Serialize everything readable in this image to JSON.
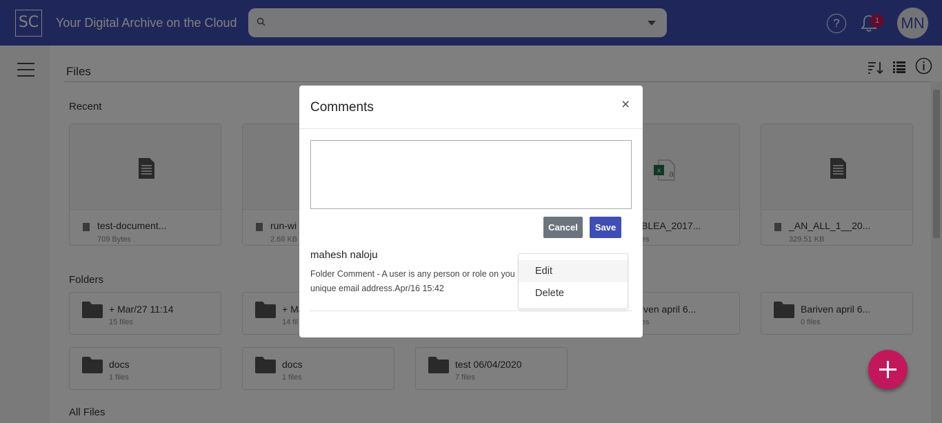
{
  "header": {
    "logo": "SC",
    "title": "Your Digital Archive on the Cloud",
    "search_placeholder": "",
    "help": "?",
    "notifications_count": "1",
    "avatar_initials": "MN"
  },
  "page": {
    "title": "Files",
    "recent_label": "Recent",
    "folders_label": "Folders",
    "all_files_label": "All Files"
  },
  "recent": [
    {
      "name": "test-document...",
      "size": "709 Bytes"
    },
    {
      "name": "run-wi",
      "size": "2.68 KB"
    },
    {
      "name": "BLEA_2017...",
      "size": "es"
    },
    {
      "name": "_AN_ALL_1__20...",
      "size": "329.51 KB"
    }
  ],
  "folders": [
    {
      "name": "+ Mar/27 11:14",
      "count": "15 files"
    },
    {
      "name": "+ Ma",
      "count": "14 fil"
    },
    {
      "name": "iven april 6...",
      "count": "es"
    },
    {
      "name": "Bariven april 6...",
      "count": "0 files"
    },
    {
      "name": "docs",
      "count": "1 files"
    },
    {
      "name": "docs",
      "count": "1 files"
    },
    {
      "name": "test 06/04/2020",
      "count": "7 files"
    }
  ],
  "modal": {
    "title": "Comments",
    "close": "×",
    "textarea_value": "",
    "cancel_label": "Cancel",
    "save_label": "Save",
    "comment": {
      "author": "mahesh naloju",
      "text": "Folder Comment - A user is any person or role on you unique email address.Apr/16 15:42"
    },
    "menu": {
      "edit": "Edit",
      "delete": "Delete"
    }
  },
  "colors": {
    "header": "#3f4eb5",
    "accent": "#c2185b",
    "save_button": "#3f4eb5",
    "cancel_button": "#6c757d"
  }
}
